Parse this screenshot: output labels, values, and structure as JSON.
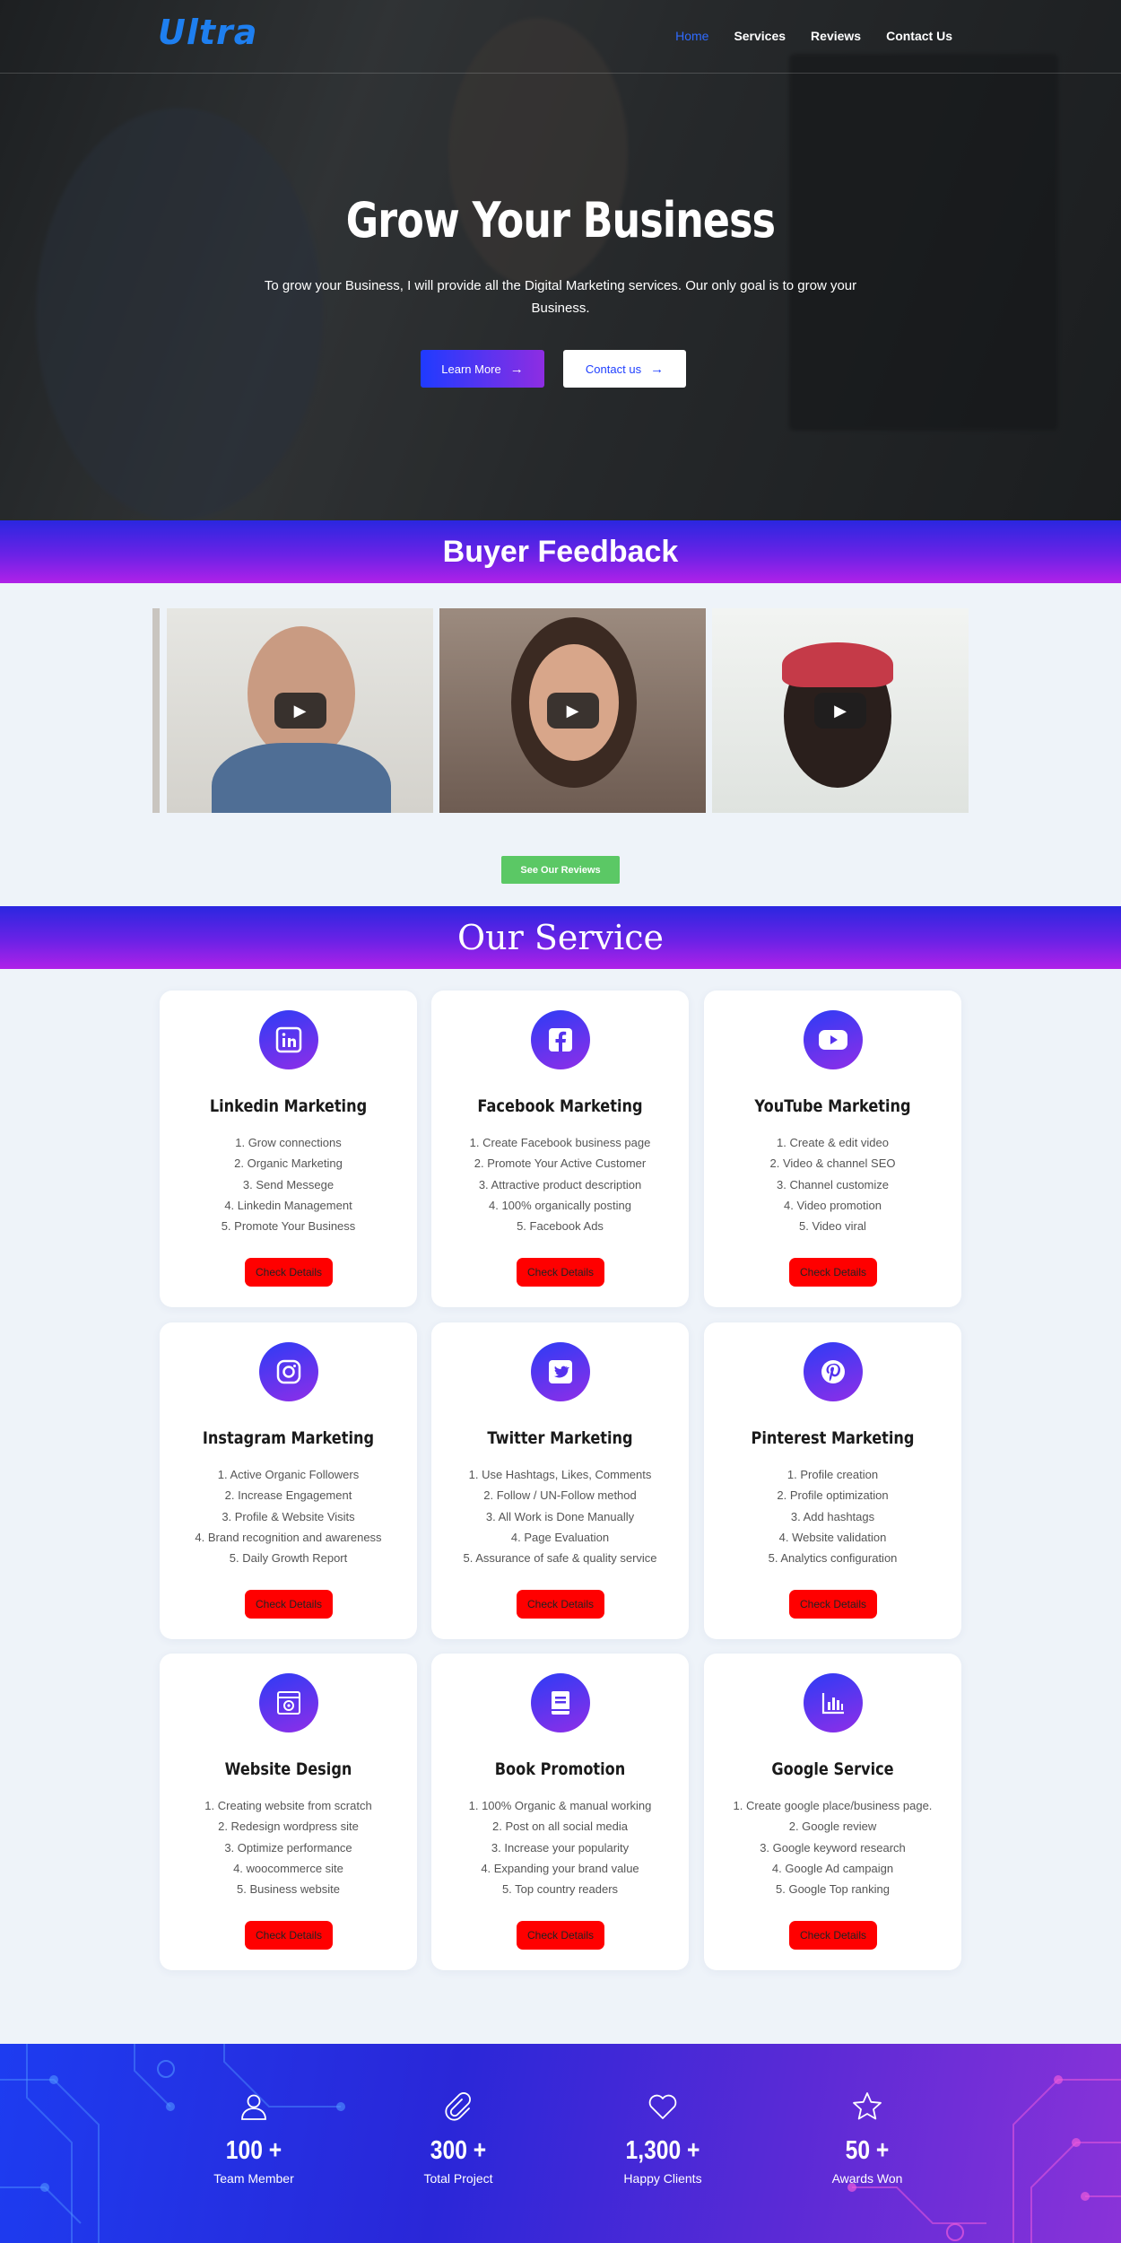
{
  "nav": {
    "logo": "Ultra",
    "items": [
      "Home",
      "Services",
      "Reviews",
      "Contact Us"
    ]
  },
  "hero": {
    "title": "Grow Your Business",
    "subtitle": "To grow your Business, I will provide all the Digital Marketing services. Our only goal is to grow your Business.",
    "learn_more": "Learn More",
    "contact_us": "Contact us"
  },
  "feedback": {
    "heading": "Buyer Feedback",
    "reviews_button": "See Our Reviews"
  },
  "services": {
    "heading": "Our Service",
    "cards": [
      {
        "title": "Linkedin Marketing",
        "icon": "linkedin-icon",
        "items": [
          "1. Grow connections",
          "2. Organic Marketing",
          "3. Send Messege",
          "4. Linkedin Management",
          "5. Promote Your Business"
        ],
        "button": "Check Details"
      },
      {
        "title": "Facebook Marketing",
        "icon": "facebook-icon",
        "items": [
          "1. Create Facebook business page",
          "2. Promote Your Active Customer",
          "3. Attractive product description",
          "4. 100% organically posting",
          "5. Facebook Ads"
        ],
        "button": "Check Details"
      },
      {
        "title": "YouTube Marketing",
        "icon": "youtube-icon",
        "items": [
          "1. Create & edit video",
          "2. Video & channel SEO",
          "3. Channel customize",
          "4. Video promotion",
          "5. Video viral"
        ],
        "button": "Check Details"
      },
      {
        "title": "Instagram Marketing",
        "icon": "instagram-icon",
        "items": [
          "1. Active Organic Followers",
          "2. Increase Engagement",
          "3. Profile & Website Visits",
          "4. Brand recognition and awareness",
          "5. Daily Growth Report"
        ],
        "button": "Check Details"
      },
      {
        "title": "Twitter Marketing",
        "icon": "twitter-icon",
        "items": [
          "1. Use Hashtags, Likes, Comments",
          "2. Follow / UN-Follow method",
          "3. All Work is Done Manually",
          "4. Page Evaluation",
          "5. Assurance of safe & quality service"
        ],
        "button": "Check Details"
      },
      {
        "title": "Pinterest Marketing",
        "icon": "pinterest-icon",
        "items": [
          "1. Profile creation",
          "2. Profile optimization",
          "3. Add hashtags",
          "4. Website validation",
          "5. Analytics configuration"
        ],
        "button": "Check Details"
      },
      {
        "title": "Website Design",
        "icon": "web-design-icon",
        "items": [
          "1. Creating website from scratch",
          "2. Redesign wordpress site",
          "3. Optimize performance",
          "4. woocommerce site",
          "5. Business website"
        ],
        "button": "Check Details"
      },
      {
        "title": "Book Promotion",
        "icon": "book-icon",
        "items": [
          "1. 100% Organic & manual working",
          "2. Post on all social media",
          "3. Increase your popularity",
          "4. Expanding your brand value",
          "5. Top country readers"
        ],
        "button": "Check Details"
      },
      {
        "title": "Google Service",
        "icon": "chart-icon",
        "items": [
          "1. Create google place/business page.",
          "2. Google review",
          "3. Google keyword research",
          "4. Google Ad campaign",
          "5. Google Top ranking"
        ],
        "button": "Check Details"
      }
    ]
  },
  "stats": [
    {
      "number": "100 +",
      "label": "Team Member",
      "icon": "user-icon"
    },
    {
      "number": "300 +",
      "label": "Total Project",
      "icon": "paperclip-icon"
    },
    {
      "number": "1,300 +",
      "label": "Happy Clients",
      "icon": "heart-icon"
    },
    {
      "number": "50 +",
      "label": "Awards Won",
      "icon": "star-icon"
    }
  ],
  "colors": {
    "accent_gradient_start": "#2a27e0",
    "accent_gradient_end": "#b021e8",
    "card_button": "#ff0000",
    "reviews_button": "#5bc865",
    "nav_active": "#2f6bff"
  }
}
